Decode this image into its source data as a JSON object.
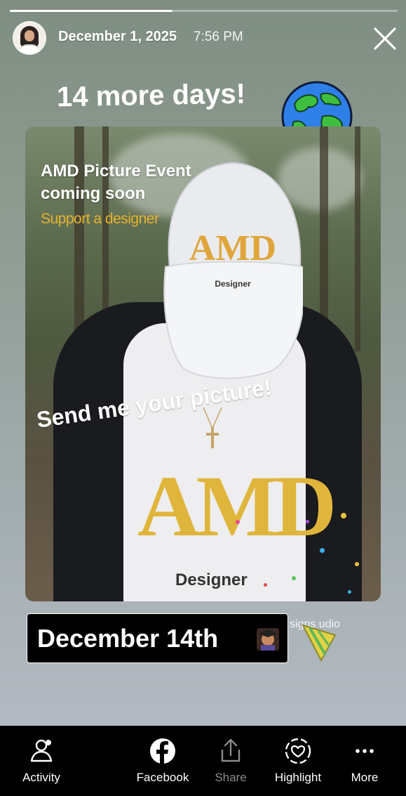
{
  "header": {
    "date": "December 1, 2025",
    "time": "7:56 PM",
    "progress_fraction": 0.42
  },
  "story": {
    "countdown_text": "14 more days!",
    "event_title": "AMD Picture Event coming soon",
    "support_text": "Support a designer",
    "call_to_action": "Send me your picture!",
    "date_sticker": "December 14th",
    "watermark": "signs  udio",
    "cap_logo": "AMD",
    "cap_text": "Designer",
    "shirt_logo": "AMD",
    "shirt_text": "Designer"
  },
  "actions": [
    {
      "label": "Activity",
      "icon": "activity-icon",
      "enabled": true
    },
    {
      "label": "Facebook",
      "icon": "facebook-icon",
      "enabled": true
    },
    {
      "label": "Share",
      "icon": "share-icon",
      "enabled": false
    },
    {
      "label": "Highlight",
      "icon": "highlight-icon",
      "enabled": true
    },
    {
      "label": "More",
      "icon": "more-icon",
      "enabled": true
    }
  ],
  "colors": {
    "accent_gold": "#e0b53b",
    "background_top": "#7f8e82",
    "bottom_bar": "#000000"
  }
}
